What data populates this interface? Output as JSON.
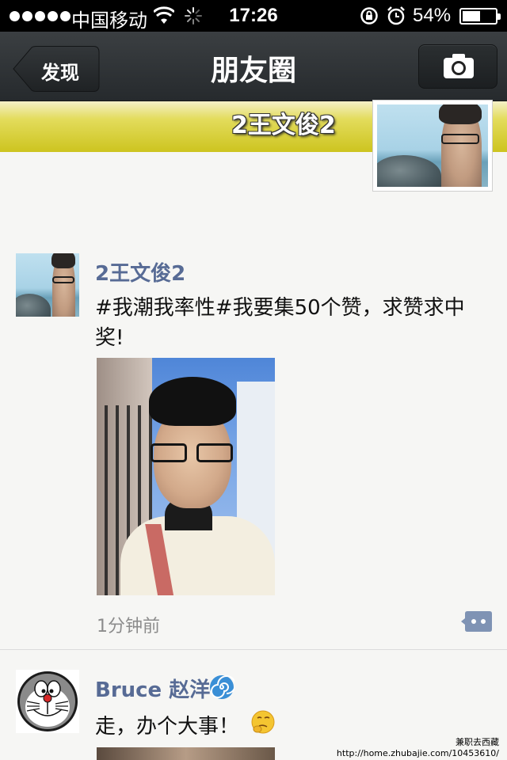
{
  "status_bar": {
    "carrier": "中国移动",
    "time": "17:26",
    "battery_percent_text": "54%",
    "battery_level": 0.54,
    "icons": [
      "signal-dots-icon",
      "wifi-icon",
      "activity-spinner-icon",
      "rotation-lock-icon",
      "alarm-icon",
      "battery-icon"
    ]
  },
  "nav": {
    "back_label": "发现",
    "title": "朋友圈",
    "camera_icon": "camera-icon"
  },
  "cover": {
    "user_name": "2王文俊2"
  },
  "posts": [
    {
      "author": "2王文俊2",
      "text": "#我潮我率性#我要集50个赞，求赞求中奖!",
      "time": "1分钟前",
      "comment_icon": "comment-icon"
    },
    {
      "author": "Bruce 赵洋",
      "author_emoji": "swirl-emoji-icon",
      "text": "走，办个大事！",
      "text_emoji": "thinking-emoji-icon"
    }
  ],
  "watermark": {
    "line1": "兼职去西藏",
    "line2": "http://home.zhubajie.com/10453610/"
  },
  "colors": {
    "name_link": "#576b95",
    "nav_bar": "#2f3336",
    "cover_band": "#d6cd2a"
  }
}
